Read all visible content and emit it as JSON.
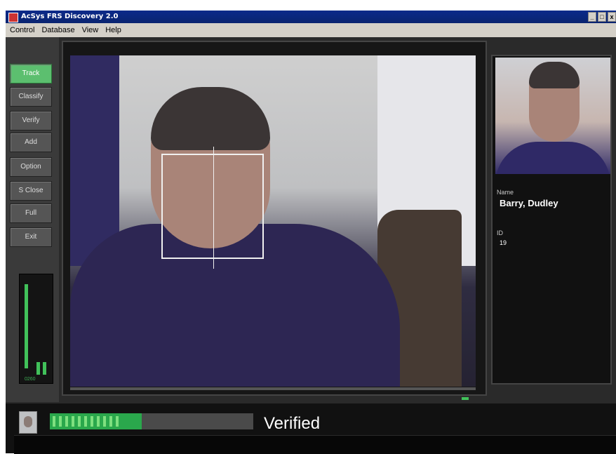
{
  "window": {
    "title": "AcSys FRS Discovery 2.0",
    "controls": [
      "_",
      "□",
      "x"
    ]
  },
  "menu": {
    "items": [
      "Control",
      "Database",
      "View",
      "Help"
    ]
  },
  "commands": [
    {
      "label": "Track",
      "active": true
    },
    {
      "label": "Classify",
      "active": false
    },
    {
      "label": "Verify",
      "active": false
    },
    {
      "label": "Add",
      "active": false
    },
    {
      "label": "Option",
      "active": false
    },
    {
      "label": "S Close",
      "active": false
    },
    {
      "label": "Full",
      "active": false
    },
    {
      "label": "Exit",
      "active": false
    }
  ],
  "meter": {
    "label": "0260"
  },
  "person": {
    "name_label": "Name",
    "name_value": "Barry, Dudley",
    "id_label": "ID",
    "id_value": "19"
  },
  "status": {
    "text": "Verified",
    "progress_percent": 45
  },
  "colors": {
    "accent_green": "#41c15a",
    "active_button": "#5cbf6f",
    "panel_bg": "#2a2a2a"
  },
  "icons": {
    "app": "app-icon",
    "avatar": "face-thumbnail-icon"
  }
}
